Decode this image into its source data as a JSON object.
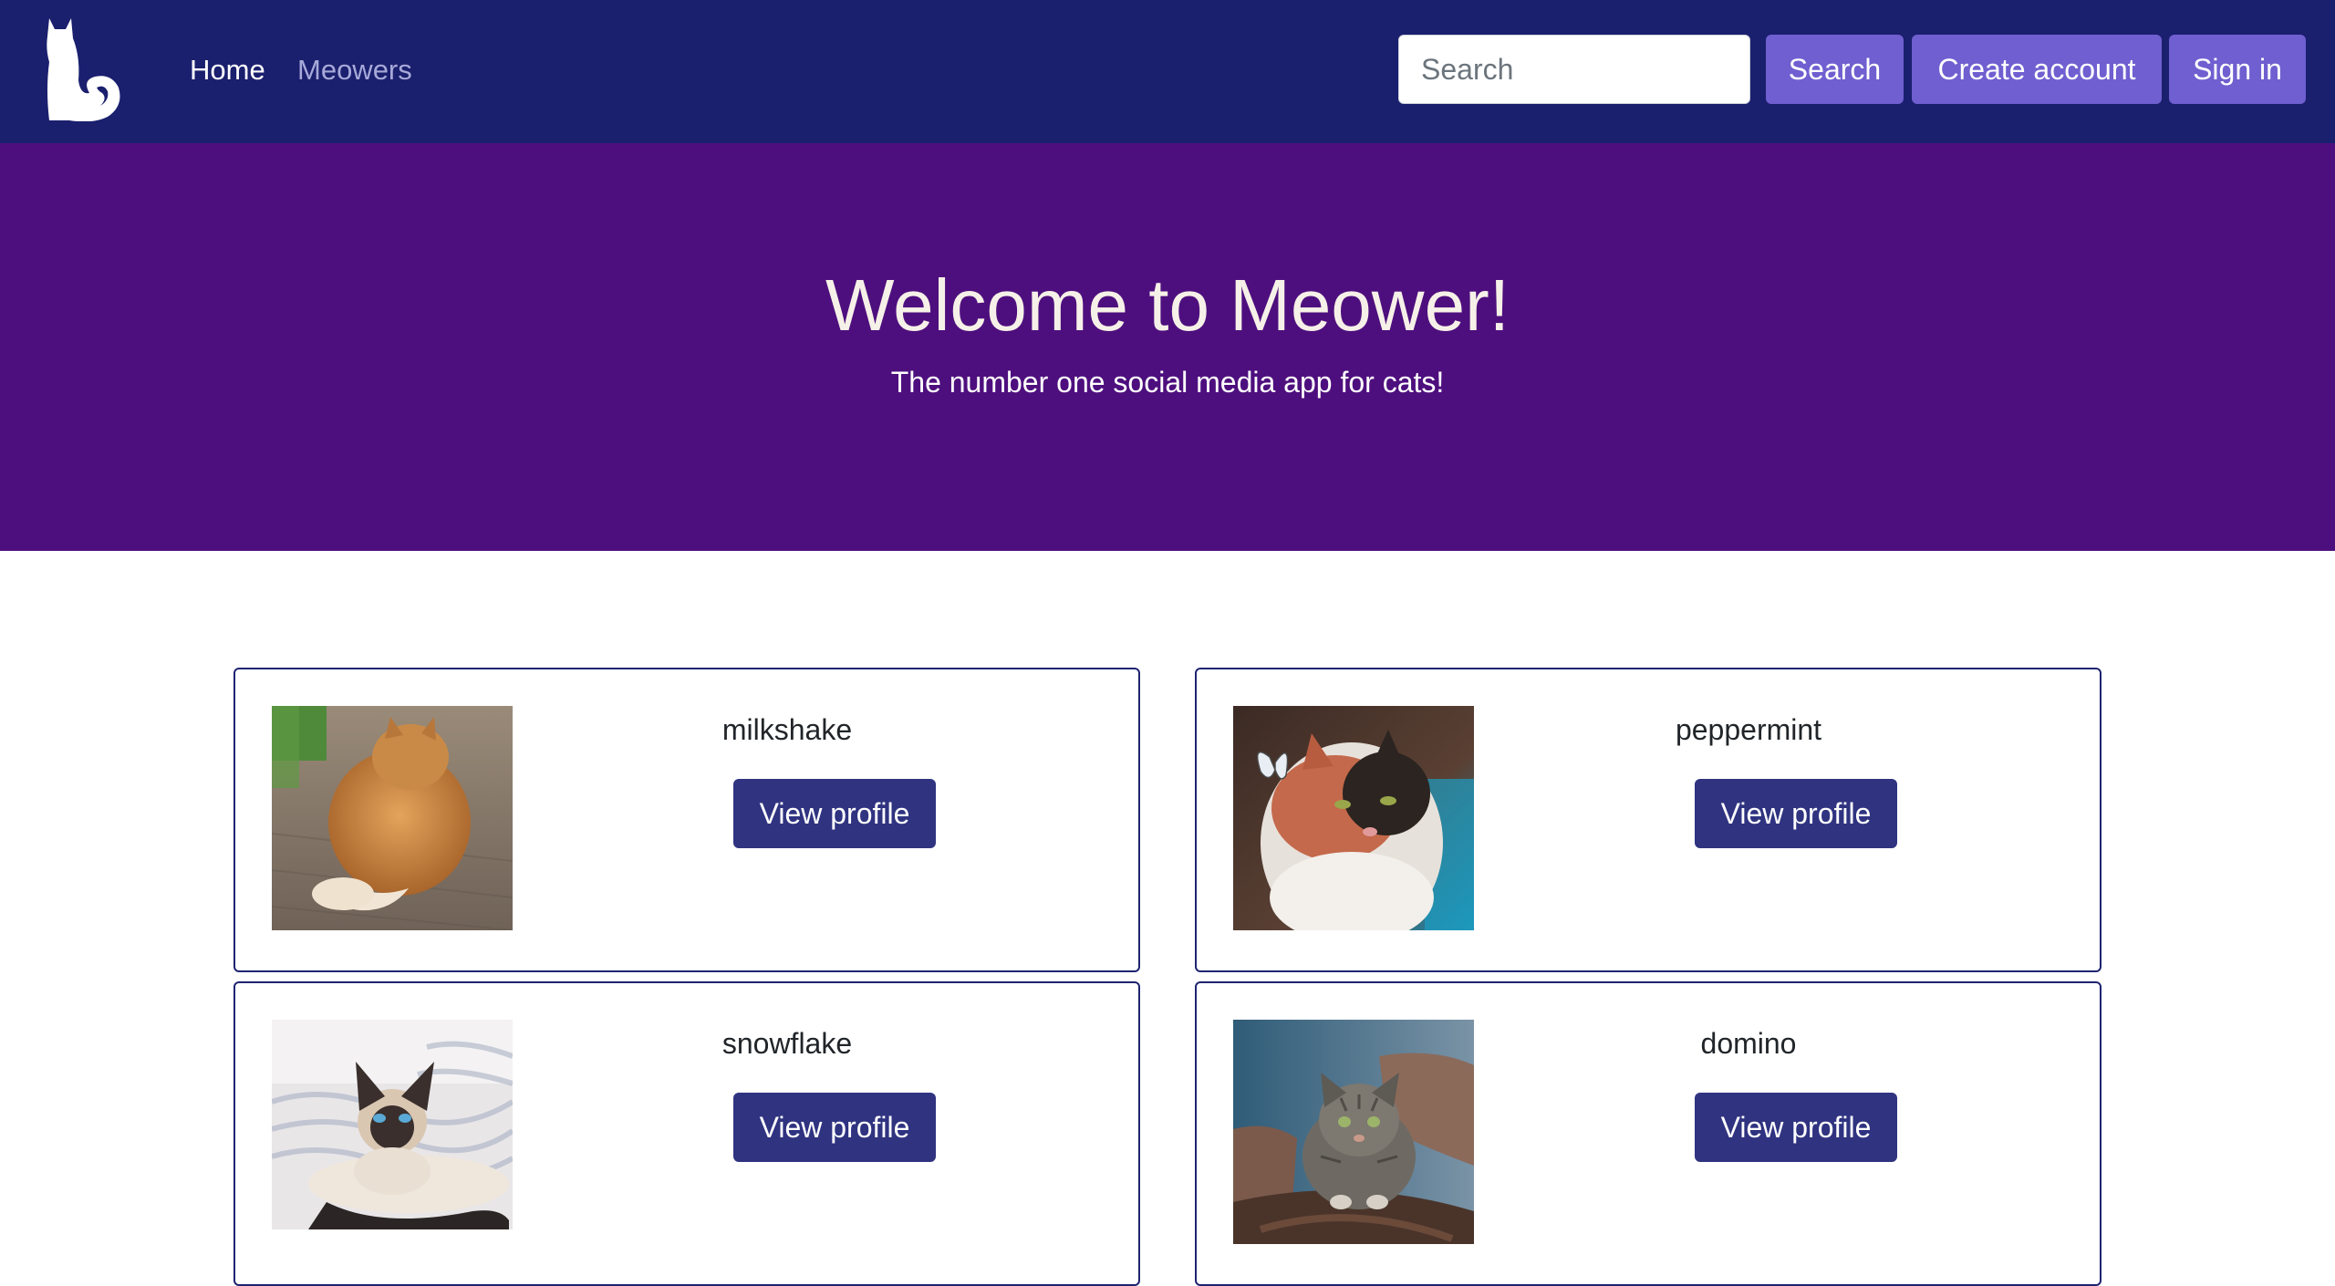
{
  "nav": {
    "logo_icon": "cat-silhouette-icon",
    "links": [
      {
        "label": "Home",
        "active": true
      },
      {
        "label": "Meowers",
        "active": false
      }
    ],
    "search_placeholder": "Search",
    "search_button": "Search",
    "create_account_button": "Create account",
    "sign_in_button": "Sign in"
  },
  "hero": {
    "title": "Welcome to Meower!",
    "subtitle": "The number one social media app for cats!"
  },
  "profiles": [
    {
      "name": "milkshake",
      "button": "View profile"
    },
    {
      "name": "peppermint",
      "button": "View profile"
    },
    {
      "name": "snowflake",
      "button": "View profile"
    },
    {
      "name": "domino",
      "button": "View profile"
    }
  ],
  "colors": {
    "navbar": "#1a1f6e",
    "hero": "#4e0f7e",
    "nav_button": "#6f5fd0",
    "view_button": "#2f3380",
    "card_border": "#1f2470"
  }
}
